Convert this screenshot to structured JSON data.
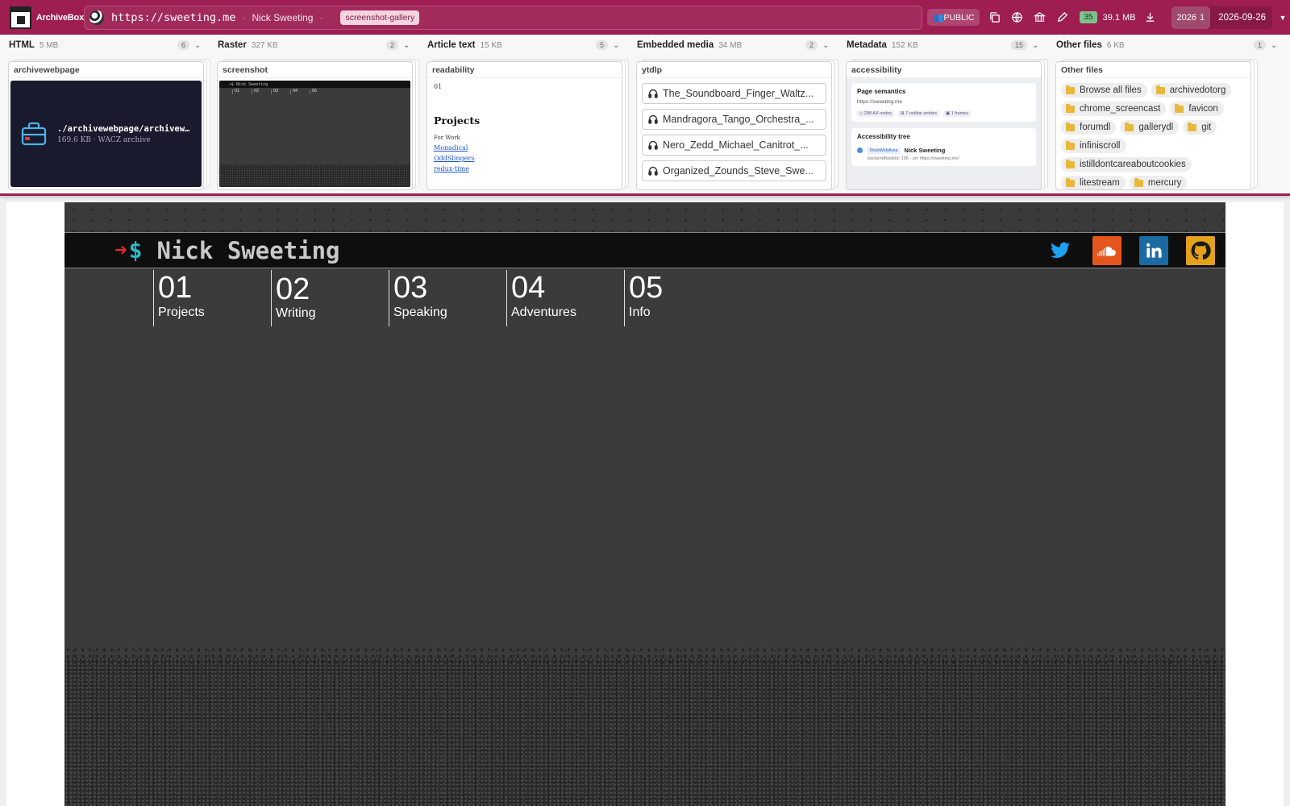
{
  "topbar": {
    "brand": "ArchiveBox",
    "url": "https://sweeting.me",
    "site_title": "Nick Sweeting",
    "tag": "screenshot-gallery",
    "public_label": "PUBLIC",
    "count": "35",
    "size": "39.1 MB",
    "year": "2026",
    "year_count": "1",
    "date": "2026-09-26",
    "colors": {
      "bar": "#9e1e52",
      "accent": "#7cc28c"
    }
  },
  "panels": {
    "html": {
      "title": "HTML",
      "size": "5 MB",
      "count": "6",
      "card_title": "archivewebpage",
      "path": "./archivewebpage/archivewebpage.wacz",
      "meta": "169.6 KB · WACZ archive"
    },
    "raster": {
      "title": "Raster",
      "size": "327 KB",
      "count": "2",
      "card_title": "screenshot",
      "mini_title": "➜$ Nick Sweeting",
      "mini_nav": [
        "01",
        "02",
        "03",
        "04",
        "05"
      ]
    },
    "article": {
      "title": "Article text",
      "size": "15 KB",
      "count": "5",
      "card_title": "readability",
      "num": "01",
      "heading": "Projects",
      "sub": "For Work",
      "links": [
        "Monadical",
        "OddSlingers",
        "redux-time"
      ]
    },
    "media": {
      "title": "Embedded media",
      "size": "34 MB",
      "count": "2",
      "card_title": "ytdlp",
      "items": [
        "The_Soundboard_Finger_Waltz...",
        "Mandragora_Tango_Orchestra_...",
        "Nero_Zedd_Michael_Canitrot_...",
        "Organized_Zounds_Steve_Swe..."
      ]
    },
    "metadata": {
      "title": "Metadata",
      "size": "152 KB",
      "count": "15",
      "card_title": "accessibility",
      "semantics_title": "Page semantics",
      "semantics_url": "https://sweeting.me",
      "chips": [
        "◇ 298 AX nodes",
        "⊞ 7 outline entries",
        "▣ 1 frames"
      ],
      "tree_title": "Accessibility tree",
      "tree_role": "RootWebArea",
      "tree_name": "Nick Sweeting",
      "tree_sub": "backendNodeId: 195 · url: https://sweeting.me/"
    },
    "other": {
      "title": "Other files",
      "size": "6 KB",
      "count": "1",
      "card_title": "Other files",
      "files": [
        "Browse all files",
        "archivedotorg",
        "chrome_screencast",
        "favicon",
        "forumdl",
        "gallerydl",
        "git",
        "infiniscroll",
        "istilldontcareaboutcookies",
        "litestream",
        "mercury"
      ]
    }
  },
  "site": {
    "prompt_arrow": "➜",
    "prompt_dollar": "$",
    "name": "Nick Sweeting",
    "nav": [
      {
        "num": "01",
        "label": "Projects"
      },
      {
        "num": "02",
        "label": "Writing"
      },
      {
        "num": "03",
        "label": "Speaking"
      },
      {
        "num": "04",
        "label": "Adventures"
      },
      {
        "num": "05",
        "label": "Info"
      }
    ],
    "socials": [
      "twitter-icon",
      "soundcloud-icon",
      "linkedin-icon",
      "github-icon"
    ]
  }
}
